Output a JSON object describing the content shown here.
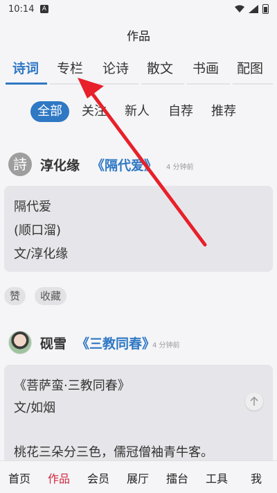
{
  "status_bar": {
    "time": "10:14",
    "notif": "A"
  },
  "header": {
    "title": "作品"
  },
  "top_tabs": [
    {
      "label": "诗词",
      "active": true
    },
    {
      "label": "专栏"
    },
    {
      "label": "论诗"
    },
    {
      "label": "散文"
    },
    {
      "label": "书画"
    },
    {
      "label": "配图"
    }
  ],
  "filters": [
    {
      "label": "全部",
      "active": true
    },
    {
      "label": "关注"
    },
    {
      "label": "新人"
    },
    {
      "label": "自荐"
    },
    {
      "label": "推荐"
    }
  ],
  "posts": [
    {
      "avatar_char": "詩",
      "author": "淳化缘",
      "title": "《隔代爱》",
      "time": "4 分钟前",
      "lines": [
        "隔代爱",
        "(顺口溜)",
        "文/淳化缘"
      ],
      "actions": [
        "赞",
        "收藏"
      ]
    },
    {
      "author": "砚雪",
      "title": "《三教同春》",
      "time": "4 分钟前",
      "lines": [
        "《菩萨蛮·三教同春》",
        "文/如烟",
        "",
        "桃花三朵分三色，儒冠僧袖青牛客。"
      ]
    }
  ],
  "bottom_nav": [
    {
      "label": "首页"
    },
    {
      "label": "作品",
      "active": true
    },
    {
      "label": "会员"
    },
    {
      "label": "展厅"
    },
    {
      "label": "擂台"
    },
    {
      "label": "工具"
    },
    {
      "label": "我"
    }
  ],
  "colors": {
    "accent": "#2f78c4",
    "nav_active": "#d0263c",
    "arrow": "#e8202a"
  }
}
